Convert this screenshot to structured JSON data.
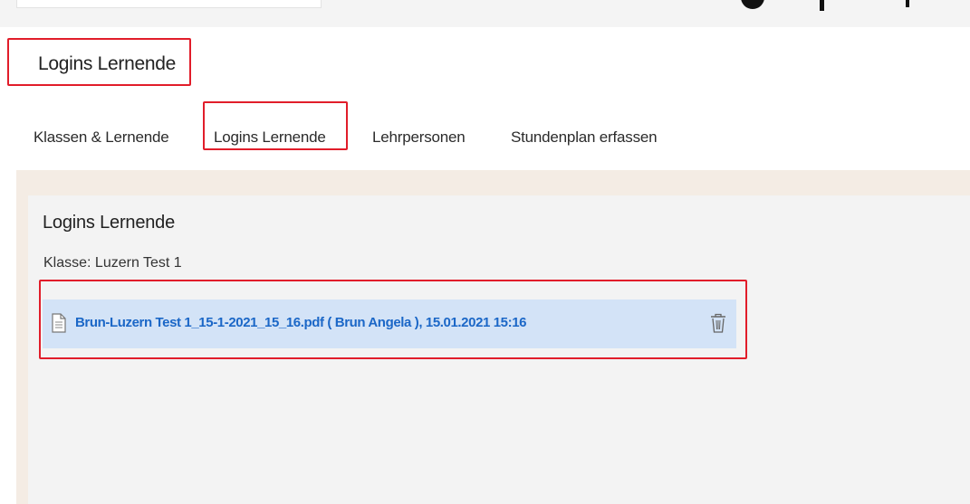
{
  "page": {
    "title": "Logins Lernende"
  },
  "tabs": [
    {
      "label": "Klassen & Lernende",
      "active": false
    },
    {
      "label": "Logins Lernende",
      "active": true
    },
    {
      "label": "Lehrpersonen",
      "active": false
    },
    {
      "label": "Stundenplan erfassen",
      "active": false
    }
  ],
  "panel": {
    "title": "Logins Lernende",
    "klasse_label": "Klasse: Luzern Test 1",
    "files": [
      {
        "link_text": "Brun-Luzern Test 1_15-1-2021_15_16.pdf ( Brun Angela ), 15.01.2021 15:16",
        "icon": "document-icon",
        "action_icon": "trash-icon"
      }
    ]
  },
  "colors": {
    "highlight_border": "#e11d2a",
    "link": "#1b67c7",
    "file_row_bg": "#d3e3f7",
    "content_band": "#f4ece4",
    "panel_bg": "#f3f3f3"
  }
}
